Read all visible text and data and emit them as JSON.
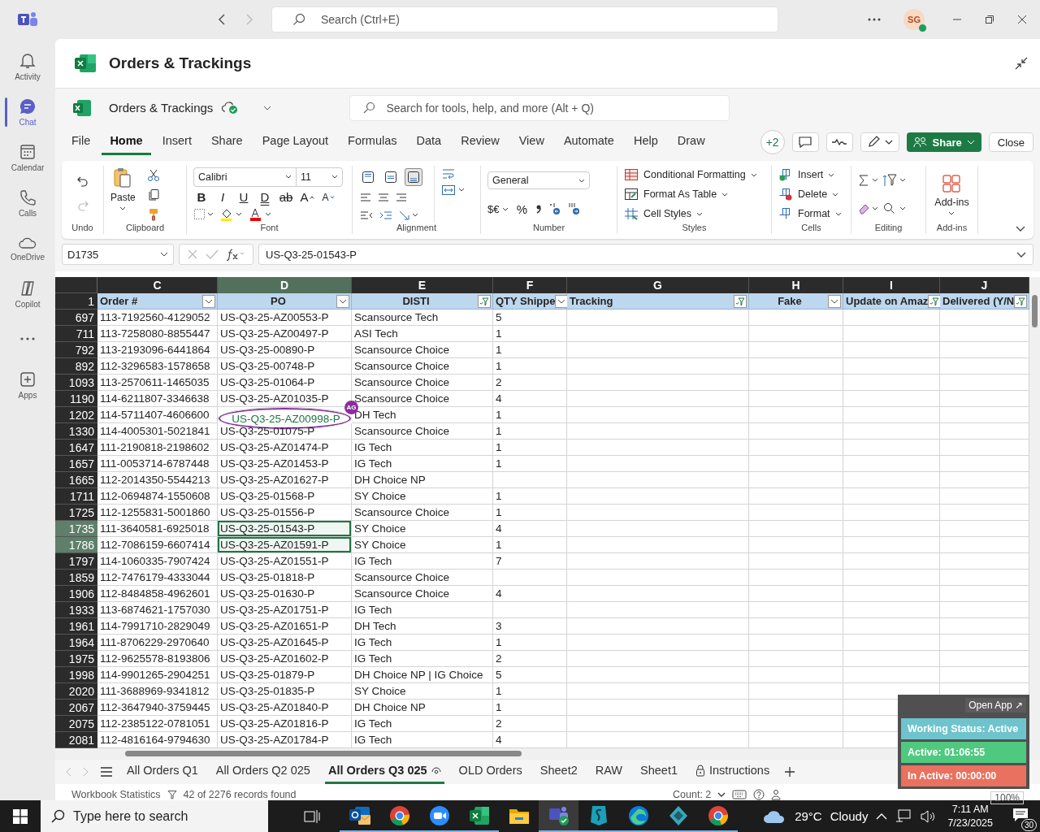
{
  "teams": {
    "search_placeholder": "Search (Ctrl+E)",
    "avatar": "SG",
    "rail": [
      {
        "kind": "activity",
        "label": "Activity",
        "selected": false
      },
      {
        "kind": "chat",
        "label": "Chat",
        "selected": true
      },
      {
        "kind": "calendar",
        "label": "Calendar",
        "selected": false
      },
      {
        "kind": "calls",
        "label": "Calls",
        "selected": false
      },
      {
        "kind": "onedrive",
        "label": "OneDrive",
        "selected": false
      },
      {
        "kind": "copilot",
        "label": "Copilot",
        "selected": false
      },
      {
        "kind": "more",
        "selected": false
      },
      {
        "kind": "apps",
        "label": "Apps",
        "selected": false
      }
    ]
  },
  "app_header": {
    "title": "Orders & Trackings"
  },
  "excel": {
    "file_name": "Orders & Trackings",
    "search_placeholder": "Search for tools, help, and more (Alt + Q)",
    "menu_tabs": [
      {
        "label": "File",
        "selected": false
      },
      {
        "label": "Home",
        "selected": true
      },
      {
        "label": "Insert",
        "selected": false
      },
      {
        "label": "Share",
        "selected": false
      },
      {
        "label": "Page Layout",
        "selected": false
      },
      {
        "label": "Formulas",
        "selected": false
      },
      {
        "label": "Data",
        "selected": false
      },
      {
        "label": "Review",
        "selected": false
      },
      {
        "label": "View",
        "selected": false
      },
      {
        "label": "Automate",
        "selected": false
      },
      {
        "label": "Help",
        "selected": false
      },
      {
        "label": "Draw",
        "selected": false
      }
    ],
    "collaborators": "+2",
    "share": "Share",
    "close": "Close"
  },
  "ribbon": {
    "undo": {
      "label": "Undo"
    },
    "clipboard": {
      "label": "Clipboard",
      "paste": "Paste"
    },
    "font": {
      "label": "Font",
      "name": "Calibri",
      "size": "11",
      "format_buttons": [
        {
          "kind": "bold",
          "label": "B"
        },
        {
          "kind": "italic",
          "label": "I"
        },
        {
          "kind": "underline",
          "label": "U"
        },
        {
          "kind": "double_underline",
          "label": "D"
        },
        {
          "kind": "strike",
          "label": "ab"
        },
        {
          "kind": "grow",
          "label": "A"
        },
        {
          "kind": "shrink",
          "label": "A"
        }
      ]
    },
    "alignment": {
      "label": "Alignment",
      "vertical_align": [
        {
          "selected": false
        },
        {
          "selected": false
        },
        {
          "selected": true
        }
      ]
    },
    "number": {
      "label": "Number",
      "format": "General",
      "currency": "$€",
      "percent": "%"
    },
    "styles": {
      "label": "Styles",
      "items": [
        {
          "kind": "conditional",
          "label": "Conditional Formatting"
        },
        {
          "kind": "table",
          "label": "Format As Table"
        },
        {
          "kind": "cell_styles",
          "label": "Cell Styles"
        }
      ]
    },
    "cells": {
      "label": "Cells",
      "items": [
        {
          "kind": "insert",
          "label": "Insert"
        },
        {
          "kind": "delete",
          "label": "Delete"
        },
        {
          "kind": "format",
          "label": "Format"
        }
      ]
    },
    "editing": {
      "label": "Editing"
    },
    "addins": {
      "label": "Add-ins",
      "button": "Add-ins"
    }
  },
  "formula_bar": {
    "name_box": "D1735",
    "formula": "US-Q3-25-01543-P"
  },
  "grid": {
    "header_row": "1",
    "columns": [
      {
        "letter": "C",
        "header": "Order #",
        "filtered": false,
        "selected": false
      },
      {
        "letter": "D",
        "header": "PO",
        "filtered": false,
        "selected": true
      },
      {
        "letter": "E",
        "header": "DISTI",
        "filtered": true,
        "selected": false
      },
      {
        "letter": "F",
        "header": "QTY Shippe",
        "filtered": false,
        "selected": false
      },
      {
        "letter": "G",
        "header": "Tracking",
        "filtered": true,
        "selected": false
      },
      {
        "letter": "H",
        "header": "Fake",
        "filtered": false,
        "selected": false
      },
      {
        "letter": "I",
        "header": "Update on Amaz",
        "filtered": true,
        "selected": false
      },
      {
        "letter": "J",
        "header": "Delivered (Y/N",
        "filtered": true,
        "selected": false
      }
    ],
    "rows": [
      {
        "row": "697",
        "cells": [
          "113-7192560-4129052",
          "US-Q3-25-AZ00553-P",
          "Scansource Tech",
          "5"
        ],
        "selected": false
      },
      {
        "row": "711",
        "cells": [
          "113-7258080-8855447",
          "US-Q3-25-AZ00497-P",
          "ASI Tech",
          "1"
        ],
        "selected": false
      },
      {
        "row": "792",
        "cells": [
          "113-2193096-6441864",
          "US-Q3-25-00890-P",
          "Scansource Choice",
          "1"
        ],
        "selected": false
      },
      {
        "row": "892",
        "cells": [
          "112-3296583-1578658",
          "US-Q3-25-00748-P",
          "Scansource Choice",
          "1"
        ],
        "selected": false
      },
      {
        "row": "1093",
        "cells": [
          "113-2570611-1465035",
          "US-Q3-25-01064-P",
          "Scansource Choice",
          "2"
        ],
        "selected": false
      },
      {
        "row": "1190",
        "cells": [
          "114-6211807-3346638",
          "US-Q3-25-AZ01035-P",
          "Scansource Choice",
          "4"
        ],
        "selected": false
      },
      {
        "row": "1202",
        "cells": [
          "114-5711407-4606600",
          "US-Q3-25-AZ00998-P",
          "DH Tech",
          "1"
        ],
        "selected": false,
        "collaborator": "AG"
      },
      {
        "row": "1330",
        "cells": [
          "114-4005301-5021841",
          "US-Q3-25-01075-P",
          "Scansource Choice",
          "1"
        ],
        "selected": false
      },
      {
        "row": "1647",
        "cells": [
          "111-2190818-2198602",
          "US-Q3-25-AZ01474-P",
          "IG Tech",
          "1"
        ],
        "selected": false
      },
      {
        "row": "1657",
        "cells": [
          "111-0053714-6787448",
          "US-Q3-25-AZ01453-P",
          "IG Tech",
          "1"
        ],
        "selected": false
      },
      {
        "row": "1665",
        "cells": [
          "112-2014350-5544213",
          "US-Q3-25-AZ01627-P",
          "DH Choice NP"
        ],
        "selected": false
      },
      {
        "row": "1711",
        "cells": [
          "112-0694874-1550608",
          "US-Q3-25-01568-P",
          "SY Choice",
          "1"
        ],
        "selected": false
      },
      {
        "row": "1725",
        "cells": [
          "112-1255831-5001860",
          "US-Q3-25-01556-P",
          "Scansource Choice",
          "1"
        ],
        "selected": false
      },
      {
        "row": "1735",
        "cells": [
          "111-3640581-6925018",
          "US-Q3-25-01543-P",
          "SY Choice",
          "4"
        ],
        "selected": true
      },
      {
        "row": "1786",
        "cells": [
          "112-7086159-6607414",
          "US-Q3-25-AZ01591-P",
          "SY Choice",
          "1"
        ],
        "selected": true
      },
      {
        "row": "1797",
        "cells": [
          "114-1060335-7907424",
          "US-Q3-25-AZ01551-P",
          "IG Tech",
          "7"
        ],
        "selected": false
      },
      {
        "row": "1859",
        "cells": [
          "112-7476179-4333044",
          "US-Q3-25-01818-P",
          "Scansource Choice"
        ],
        "selected": false
      },
      {
        "row": "1906",
        "cells": [
          "112-8484858-4962601",
          "US-Q3-25-01630-P",
          "Scansource Choice",
          "4"
        ],
        "selected": false
      },
      {
        "row": "1933",
        "cells": [
          "113-6874621-1757030",
          "US-Q3-25-AZ01751-P",
          "IG Tech"
        ],
        "selected": false
      },
      {
        "row": "1961",
        "cells": [
          "114-7991710-2829049",
          "US-Q3-25-AZ01651-P",
          "DH Tech",
          "3"
        ],
        "selected": false
      },
      {
        "row": "1964",
        "cells": [
          "111-8706229-2970640",
          "US-Q3-25-AZ01645-P",
          "IG Tech",
          "1"
        ],
        "selected": false
      },
      {
        "row": "1975",
        "cells": [
          "112-9625578-8193806",
          "US-Q3-25-AZ01602-P",
          "IG Tech",
          "2"
        ],
        "selected": false
      },
      {
        "row": "1998",
        "cells": [
          "114-9901265-2904251",
          "US-Q3-25-01879-P",
          "DH Choice NP | IG Choice",
          "5"
        ],
        "selected": false
      },
      {
        "row": "2020",
        "cells": [
          "111-3688969-9341812",
          "US-Q3-25-01835-P",
          "SY Choice",
          "1"
        ],
        "selected": false
      },
      {
        "row": "2067",
        "cells": [
          "112-3647940-3759445",
          "US-Q3-25-AZ01840-P",
          "DH Choice NP",
          "1"
        ],
        "selected": false
      },
      {
        "row": "2075",
        "cells": [
          "112-2385122-0781051",
          "US-Q3-25-AZ01816-P",
          "IG Tech",
          "2"
        ],
        "selected": false
      },
      {
        "row": "2081",
        "cells": [
          "112-4816164-9794630",
          "US-Q3-25-AZ01784-P",
          "IG Tech",
          "4"
        ],
        "selected": false
      }
    ]
  },
  "sheet_tabs": [
    {
      "label": "All Orders Q1",
      "selected": false,
      "watched": false,
      "locked": false
    },
    {
      "label": "All Orders Q2 025",
      "selected": false,
      "watched": false,
      "locked": false
    },
    {
      "label": "All Orders Q3 025",
      "selected": true,
      "watched": true,
      "locked": false
    },
    {
      "label": "OLD Orders",
      "selected": false,
      "watched": false,
      "locked": false
    },
    {
      "label": "Sheet2",
      "selected": false,
      "watched": false,
      "locked": false
    },
    {
      "label": "RAW",
      "selected": false,
      "watched": false,
      "locked": false
    },
    {
      "label": "Sheet1",
      "selected": false,
      "watched": false,
      "locked": false
    },
    {
      "label": "Instructions",
      "selected": false,
      "watched": false,
      "locked": true
    }
  ],
  "status_bar": {
    "workbook_statistics": "Workbook Statistics",
    "filter_result": "42 of 2276 records found",
    "count": "Count: 2",
    "zoom": "100%"
  },
  "tracker_widget": {
    "open_app": "Open App ↗",
    "items": [
      {
        "text": "Working Status: Active",
        "color": "#6ec3cd"
      },
      {
        "text": "Active: 01:06:55",
        "color": "#4fc97f"
      },
      {
        "text": "In Active: 00:00:00",
        "color": "#e8715f"
      }
    ]
  },
  "taskbar": {
    "search_placeholder": "Type here to search",
    "apps": [
      {
        "kind": "outlook",
        "active": false,
        "running": true
      },
      {
        "kind": "chrome",
        "active": false,
        "running": true
      },
      {
        "kind": "zoom",
        "active": false,
        "running": true
      },
      {
        "kind": "excel",
        "active": false,
        "running": true
      },
      {
        "kind": "folder",
        "active": false,
        "running": false
      },
      {
        "kind": "teams",
        "active": true,
        "running": true
      },
      {
        "kind": "vpn",
        "active": false,
        "running": true
      },
      {
        "kind": "edge",
        "active": false,
        "running": true
      },
      {
        "kind": "diamond",
        "active": false,
        "running": true
      },
      {
        "kind": "chrome",
        "active": false,
        "running": true
      }
    ],
    "weather": {
      "temperature": "29°C",
      "condition": "Cloudy"
    },
    "time": "7:11 AM",
    "date": "7/23/2025",
    "notifications": "30"
  }
}
